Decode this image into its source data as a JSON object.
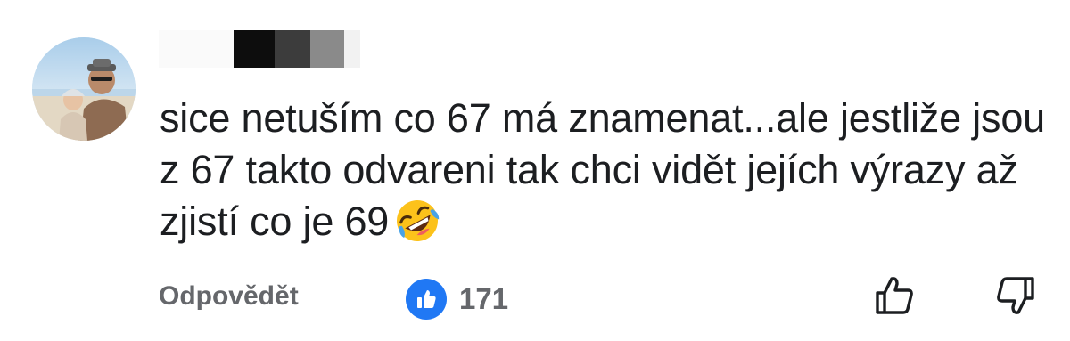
{
  "comment": {
    "author_redacted": true,
    "text": "sice netuším co 67 má znamenat...ale jestliže jsou z 67 takto odvareni tak chci vidět jejích výrazy až zjistí co je 69",
    "emoji": "rolling-on-floor-laughing",
    "reply_label": "Odpovědět",
    "reaction_count": "171",
    "reaction_type": "like",
    "reaction_color": "#2078f4"
  },
  "icons": {
    "avatar": "user-avatar-photo",
    "like_badge": "thumbs-up-icon",
    "upvote": "thumbs-up-outline-icon",
    "downvote": "thumbs-down-outline-icon"
  }
}
